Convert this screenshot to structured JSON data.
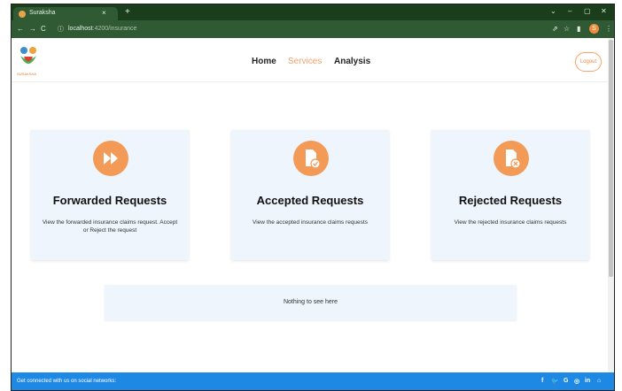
{
  "browser": {
    "tab_title": "Suraksha",
    "tab_close": "×",
    "new_tab": "+",
    "url_host": "localhost",
    "url_path": ":4200/insurance",
    "window_controls": [
      "⌄",
      "–",
      "▢",
      "✕"
    ],
    "profile_initial": "S"
  },
  "header": {
    "logo_text": "SURAKSHA",
    "nav": [
      "Home",
      "Services",
      "Analysis"
    ],
    "active_nav": "Services",
    "logout": "Logout"
  },
  "cards": [
    {
      "title": "Forwarded Requests",
      "description": "View the forwarded insurance claims request. Accept or Reject the request",
      "icon": "fast-forward-icon"
    },
    {
      "title": "Accepted Requests",
      "description": "View the accepted insurance claims requests",
      "icon": "document-check-icon"
    },
    {
      "title": "Rejected Requests",
      "description": "View the rejected insurance claims requests",
      "icon": "document-cross-icon"
    }
  ],
  "empty_message": "Nothing to see here",
  "footer": {
    "text": "Get connected with us on social networks:",
    "social": [
      "f",
      "🐦",
      "G",
      "◎",
      "in",
      "⌂"
    ]
  },
  "colors": {
    "accent": "#f39a57",
    "card_bg": "#eef5fc",
    "footer": "#1e88e5",
    "browser_chrome": "#2f5a33"
  }
}
